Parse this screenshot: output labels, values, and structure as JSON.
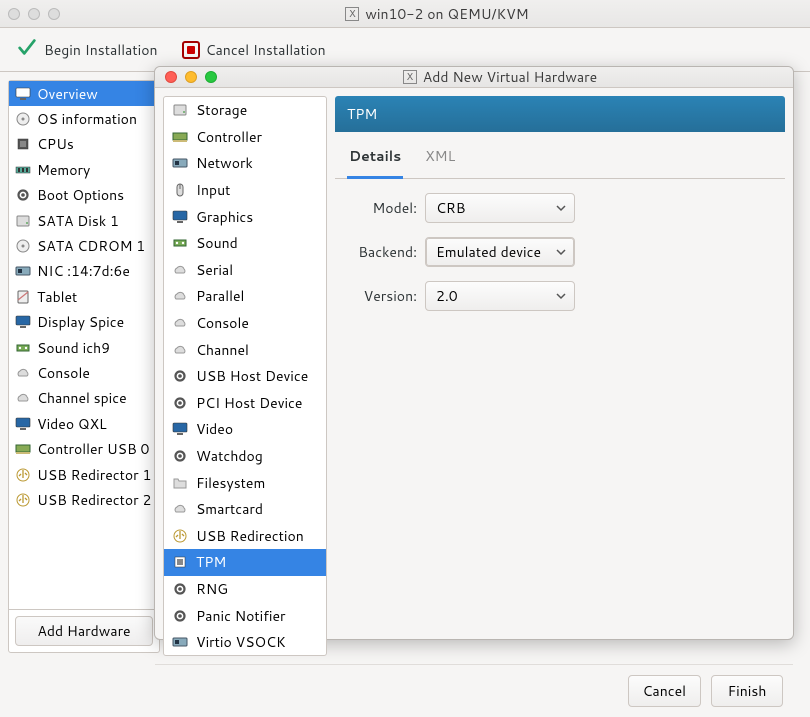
{
  "window": {
    "title": "win10-2 on QEMU/KVM"
  },
  "toolbar": {
    "begin_label": "Begin Installation",
    "cancel_label": "Cancel Installation"
  },
  "sidebar": {
    "items": [
      {
        "label": "Overview",
        "icon": "monitor",
        "color": "#fff",
        "sel": true
      },
      {
        "label": "OS information",
        "icon": "disc",
        "color": "#555"
      },
      {
        "label": "CPUs",
        "icon": "chip",
        "color": "#555"
      },
      {
        "label": "Memory",
        "icon": "ram",
        "color": "#555"
      },
      {
        "label": "Boot Options",
        "icon": "gear",
        "color": "#555"
      },
      {
        "label": "SATA Disk 1",
        "icon": "disk",
        "color": "#888"
      },
      {
        "label": "SATA CDROM 1",
        "icon": "disc",
        "color": "#888"
      },
      {
        "label": "NIC :14:7d:6e",
        "icon": "nic",
        "color": "#555"
      },
      {
        "label": "Tablet",
        "icon": "tablet",
        "color": "#555"
      },
      {
        "label": "Display Spice",
        "icon": "monitor",
        "color": "#2867a5"
      },
      {
        "label": "Sound ich9",
        "icon": "sound",
        "color": "#3a7d3a"
      },
      {
        "label": "Console",
        "icon": "cloud",
        "color": "#888"
      },
      {
        "label": "Channel spice",
        "icon": "cloud",
        "color": "#888"
      },
      {
        "label": "Video QXL",
        "icon": "monitor",
        "color": "#2867a5"
      },
      {
        "label": "Controller USB 0",
        "icon": "card",
        "color": "#5a7d2a"
      },
      {
        "label": "USB Redirector 1",
        "icon": "usb",
        "color": "#9a7d3a"
      },
      {
        "label": "USB Redirector 2",
        "icon": "usb",
        "color": "#9a7d3a"
      }
    ]
  },
  "add_hw_label": "Add Hardware",
  "dialog": {
    "title": "Add New Virtual Hardware",
    "items": [
      {
        "label": "Storage",
        "icon": "disk",
        "color": "#888"
      },
      {
        "label": "Controller",
        "icon": "card",
        "color": "#5a7d2a"
      },
      {
        "label": "Network",
        "icon": "nic",
        "color": "#555"
      },
      {
        "label": "Input",
        "icon": "mouse",
        "color": "#555"
      },
      {
        "label": "Graphics",
        "icon": "monitor",
        "color": "#2867a5"
      },
      {
        "label": "Sound",
        "icon": "sound",
        "color": "#3a7d3a"
      },
      {
        "label": "Serial",
        "icon": "cloud",
        "color": "#888"
      },
      {
        "label": "Parallel",
        "icon": "cloud",
        "color": "#888"
      },
      {
        "label": "Console",
        "icon": "cloud",
        "color": "#888"
      },
      {
        "label": "Channel",
        "icon": "cloud",
        "color": "#888"
      },
      {
        "label": "USB Host Device",
        "icon": "gear",
        "color": "#555"
      },
      {
        "label": "PCI Host Device",
        "icon": "gear",
        "color": "#555"
      },
      {
        "label": "Video",
        "icon": "monitor",
        "color": "#2867a5"
      },
      {
        "label": "Watchdog",
        "icon": "gear",
        "color": "#555"
      },
      {
        "label": "Filesystem",
        "icon": "folder",
        "color": "#888"
      },
      {
        "label": "Smartcard",
        "icon": "cloud",
        "color": "#888"
      },
      {
        "label": "USB Redirection",
        "icon": "usb",
        "color": "#9a7d3a"
      },
      {
        "label": "TPM",
        "icon": "chip",
        "color": "#fff",
        "sel": true
      },
      {
        "label": "RNG",
        "icon": "gear",
        "color": "#555"
      },
      {
        "label": "Panic Notifier",
        "icon": "gear",
        "color": "#555"
      },
      {
        "label": "Virtio VSOCK",
        "icon": "nic",
        "color": "#555"
      }
    ],
    "header": "TPM",
    "tabs": {
      "details": "Details",
      "xml": "XML"
    },
    "form": {
      "model_label": "Model:",
      "model_value": "CRB",
      "backend_label": "Backend:",
      "backend_value": "Emulated device",
      "version_label": "Version:",
      "version_value": "2.0"
    },
    "cancel": "Cancel",
    "finish": "Finish"
  }
}
